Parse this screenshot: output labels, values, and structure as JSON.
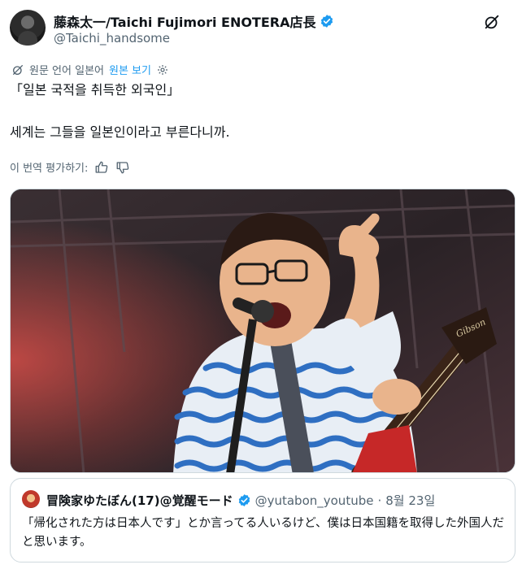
{
  "tweet": {
    "author": {
      "display_name": "藤森太一/Taichi Fujimori ENOTERA店長",
      "handle": "@Taichi_handsome",
      "verified": true
    },
    "translation": {
      "source_label": "원문 언어 일본어",
      "show_original_label": "원본 보기"
    },
    "text_line_1": "「일본 국적을 취득한 외국인」",
    "text_line_2": "세계는 그들을 일본인이라고 부른다니까.",
    "rate_label": "이 번역 평가하기:",
    "media": {
      "guitar_logo": "Gibson"
    }
  },
  "quote": {
    "author": {
      "display_name": "冒険家ゆたぼん(17)@覚醒モード",
      "handle": "@yutabon_youtube",
      "separator": "·",
      "date": "8월 23일",
      "verified": true
    },
    "text": "「帰化された方は日本人です」とか言ってる人いるけど、僕は日本国籍を取得した外国人だと思います。"
  },
  "colors": {
    "accent": "#1d9bf0",
    "secondary_text": "#536471",
    "border": "#cfd9de"
  },
  "icons": [
    "grok-icon",
    "more-icon",
    "verified-badge-icon",
    "translate-icon",
    "settings-icon",
    "thumbs-up-icon",
    "thumbs-down-icon"
  ]
}
